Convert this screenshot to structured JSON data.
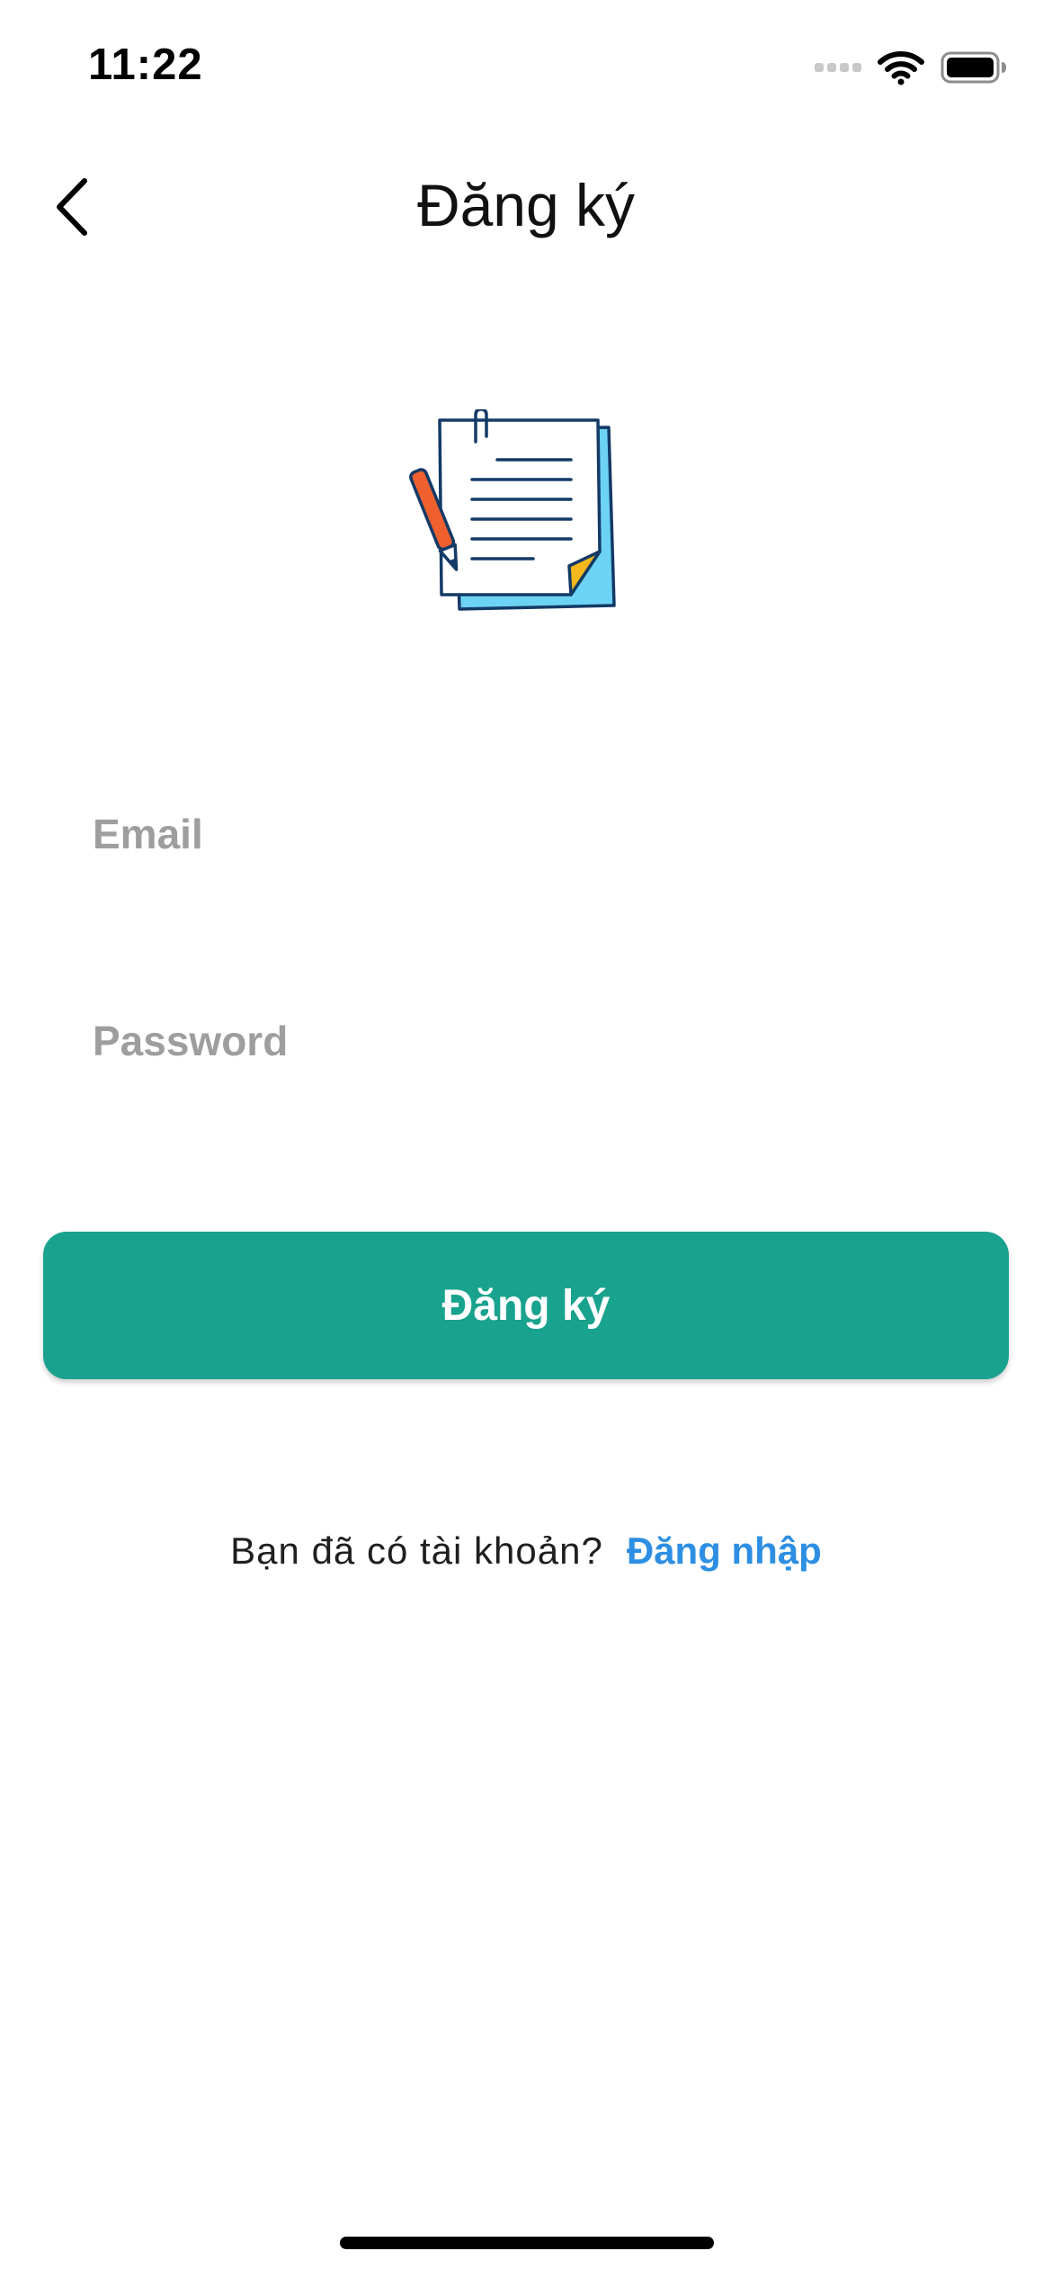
{
  "status_bar": {
    "time": "11:22",
    "icons": [
      "cellular-signal-icon",
      "wifi-icon",
      "battery-icon"
    ]
  },
  "nav": {
    "title": "Đăng ký",
    "back_icon": "chevron-left-icon"
  },
  "illustration": {
    "icon": "notepad-with-pencil-icon",
    "colors": {
      "paper": "#ffffff",
      "back_paper": "#6dd3f5",
      "outline": "#143a66",
      "pencil": "#f0602e",
      "corner_fold": "#f5b81c"
    }
  },
  "form": {
    "email_placeholder": "Email",
    "password_placeholder": "Password",
    "submit_label": "Đăng ký"
  },
  "footer": {
    "prompt": "Bạn đã có tài khoản?",
    "login_link": "Đăng nhập"
  },
  "colors": {
    "accent": "#19a28d",
    "link": "#2d8fe3",
    "placeholder": "#9e9e9e"
  }
}
